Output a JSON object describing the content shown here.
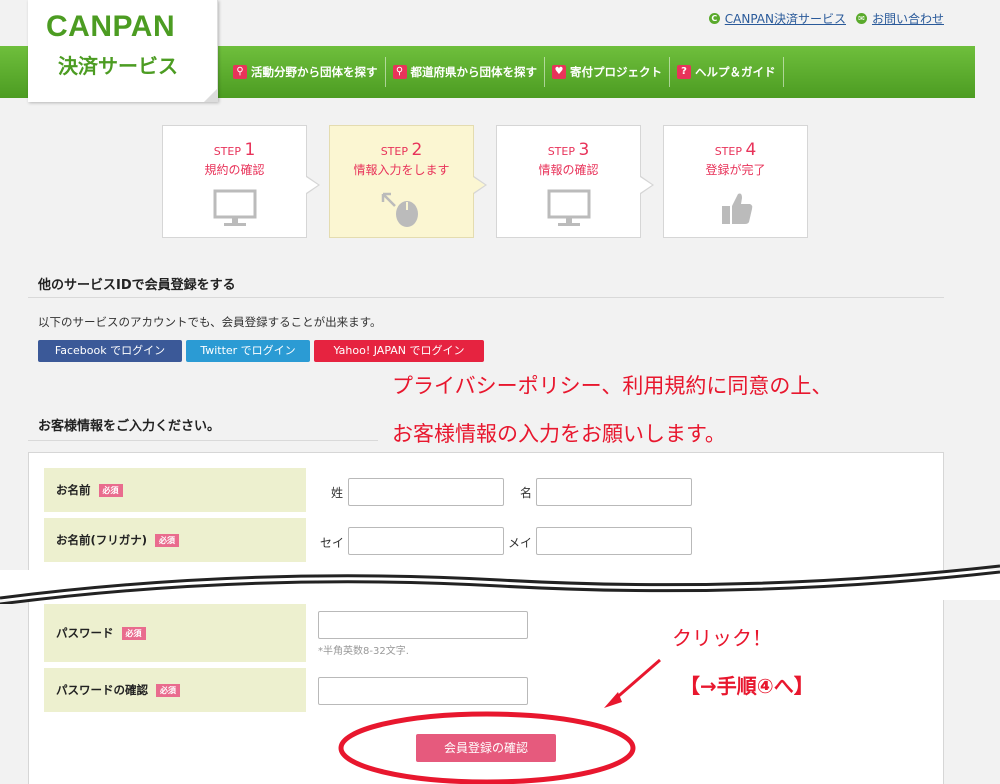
{
  "logo": {
    "main": "CANPAN",
    "sub": "決済サービス"
  },
  "top_links": [
    {
      "icon": "C",
      "label": "CANPAN決済サービス"
    },
    {
      "icon": "✉",
      "label": "お問い合わせ"
    }
  ],
  "nav": [
    {
      "label": "活動分野から団体を探す"
    },
    {
      "label": "都道府県から団体を探す"
    },
    {
      "label": "寄付プロジェクト"
    },
    {
      "label": "ヘルプ＆ガイド"
    }
  ],
  "steps": [
    {
      "prefix": "STEP",
      "num": "1",
      "title": "規約の確認"
    },
    {
      "prefix": "STEP",
      "num": "2",
      "title": "情報入力をします"
    },
    {
      "prefix": "STEP",
      "num": "3",
      "title": "情報の確認"
    },
    {
      "prefix": "STEP",
      "num": "4",
      "title": "登録が完了"
    }
  ],
  "social_section": {
    "title": "他のサービスIDで会員登録をする",
    "desc": "以下のサービスのアカウントでも、会員登録することが出来ます。",
    "buttons": [
      "Facebook でログイン",
      "Twitter でログイン",
      "Yahoo! JAPAN でログイン"
    ]
  },
  "notes": {
    "line1": "プライバシーポリシー、利用規約に同意の上、",
    "line2": "お客様情報の入力をお願いします。",
    "click": "クリック！",
    "next": "【→手順④へ】"
  },
  "form": {
    "title": "お客様情報をご入力ください。",
    "required": "必須",
    "name_label": "お名前",
    "last_name": "姓",
    "first_name": "名",
    "kana_label": "お名前(フリガナ)",
    "last_kana": "セイ",
    "first_kana": "メイ",
    "password_label": "パスワード",
    "password_hint": "*半角英数8-32文字.",
    "password_confirm_label": "パスワードの確認",
    "submit": "会員登録の確認"
  },
  "colors": {
    "green": "#4c9c22",
    "pink": "#e8335a",
    "red_note": "#e8172e"
  }
}
